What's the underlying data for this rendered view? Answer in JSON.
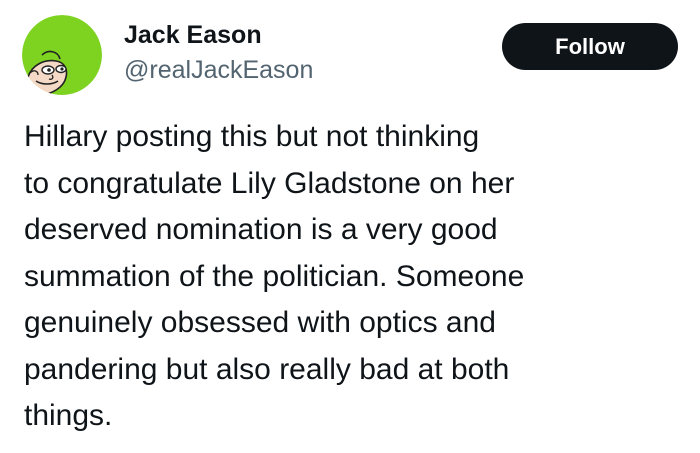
{
  "author": {
    "display_name": "Jack Eason",
    "handle": "@realJackEason",
    "avatar_icon": "cartoon-face-avatar-icon",
    "avatar_background": "#7ed321"
  },
  "follow_button": {
    "label": "Follow",
    "background": "#0f1419",
    "text_color": "#ffffff"
  },
  "tweet": {
    "lines": [
      "Hillary posting this but not thinking",
      "to congratulate Lily Gladstone on her",
      "deserved nomination is a very good",
      "summation of the politician. Someone",
      "genuinely obsessed with optics and",
      "pandering but also really bad at both",
      "things."
    ]
  },
  "colors": {
    "text": "#0f1419",
    "handle": "#536471",
    "background": "#ffffff"
  }
}
